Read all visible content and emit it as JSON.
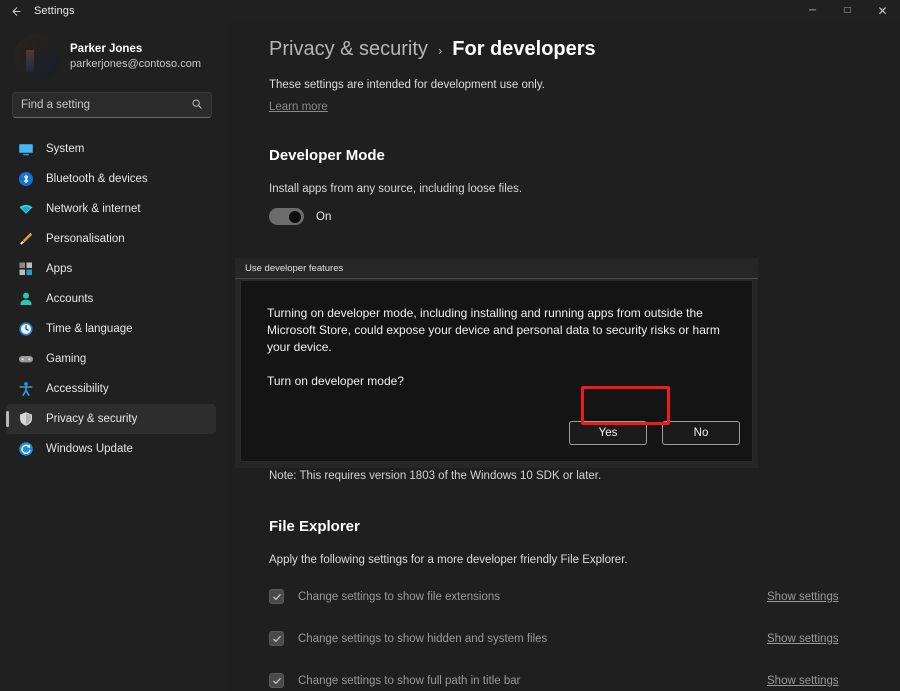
{
  "window": {
    "app_title": "Settings",
    "back_icon": "back-arrow-icon",
    "minimize_label": "─",
    "maximize_label": "□",
    "close_label": "✕"
  },
  "sidebar": {
    "profile": {
      "name": "Parker Jones",
      "email": "parkerjones@contoso.com"
    },
    "search": {
      "placeholder": "Find a setting",
      "value": "",
      "icon": "search-icon"
    },
    "items": [
      {
        "label": "System",
        "icon": "monitor-icon",
        "selected": false
      },
      {
        "label": "Bluetooth & devices",
        "icon": "bluetooth-icon",
        "selected": false
      },
      {
        "label": "Network & internet",
        "icon": "wifi-icon",
        "selected": false
      },
      {
        "label": "Personalisation",
        "icon": "paintbrush-icon",
        "selected": false
      },
      {
        "label": "Apps",
        "icon": "apps-grid-icon",
        "selected": false
      },
      {
        "label": "Accounts",
        "icon": "person-icon",
        "selected": false
      },
      {
        "label": "Time & language",
        "icon": "clock-icon",
        "selected": false
      },
      {
        "label": "Gaming",
        "icon": "gamepad-icon",
        "selected": false
      },
      {
        "label": "Accessibility",
        "icon": "accessibility-icon",
        "selected": false
      },
      {
        "label": "Privacy & security",
        "icon": "shield-icon",
        "selected": true
      },
      {
        "label": "Windows Update",
        "icon": "update-refresh-icon",
        "selected": false
      }
    ]
  },
  "main": {
    "breadcrumb": {
      "parent": "Privacy & security",
      "separator": "›",
      "current": "For developers"
    },
    "intro": {
      "text": "These settings are intended for development use only.",
      "learn_more": "Learn more"
    },
    "developer_mode": {
      "title": "Developer Mode",
      "description": "Install apps from any source, including loose files.",
      "toggle_state": "On",
      "toggle_on": true
    },
    "sdk_note": "Note: This requires version 1803 of the Windows 10 SDK or later.",
    "file_explorer": {
      "title": "File Explorer",
      "description": "Apply the following settings for a more developer friendly File Explorer.",
      "rows": [
        {
          "label": "Change settings to show file extensions",
          "checked": true,
          "action": "Show settings"
        },
        {
          "label": "Change settings to show hidden and system files",
          "checked": true,
          "action": "Show settings"
        },
        {
          "label": "Change settings to show full path in title bar",
          "checked": true,
          "action": "Show settings"
        }
      ]
    }
  },
  "dialog": {
    "title": "Use developer features",
    "message": "Turning on developer mode, including installing and running apps from outside the Microsoft Store, could expose your device and personal data to security risks or harm your device.",
    "question": "Turn on developer mode?",
    "yes_label": "Yes",
    "no_label": "No"
  },
  "annotation": {
    "highlight_color": "#ee1b1b",
    "highlight_target": "yes-button"
  }
}
